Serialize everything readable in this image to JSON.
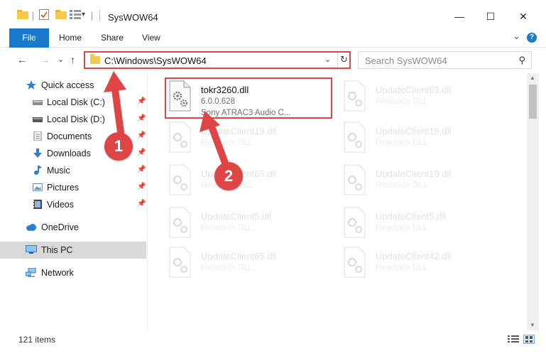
{
  "window": {
    "title": "SysWOW64",
    "minimize_label": "—",
    "maximize_label": "☐",
    "close_label": "✕"
  },
  "ribbon": {
    "tabs": [
      "File",
      "Home",
      "Share",
      "View"
    ],
    "expand_label": "⌄",
    "help_label": "?"
  },
  "address_bar": {
    "path": "C:\\Windows\\SysWOW64",
    "dropdown": "⌄",
    "refresh": "↻"
  },
  "search": {
    "placeholder": "Search SysWOW64",
    "icon": "⚲"
  },
  "nav": {
    "back": "←",
    "forward": "→",
    "recent": "⌄",
    "up": "↑"
  },
  "sidebar": {
    "quick_access": "Quick access",
    "items": [
      {
        "label": "Local Disk (C:)",
        "icon": "drive-icon"
      },
      {
        "label": "Local Disk (D:)",
        "icon": "drive-icon"
      },
      {
        "label": "Documents",
        "icon": "documents-icon"
      },
      {
        "label": "Downloads",
        "icon": "downloads-icon"
      },
      {
        "label": "Music",
        "icon": "music-icon"
      },
      {
        "label": "Pictures",
        "icon": "pictures-icon"
      },
      {
        "label": "Videos",
        "icon": "videos-icon"
      }
    ],
    "onedrive": "OneDrive",
    "this_pc": "This PC",
    "network": "Network",
    "pin_glyph": "📌"
  },
  "files": [
    {
      "name": "tokr3260.dll",
      "version": "6.0.0.628",
      "desc": "Sony ATRAC3 Audio C..."
    },
    {
      "name": "UpdateClient63.dll",
      "version": "Resource DLL",
      "desc": ""
    },
    {
      "name": "UpdateClient19.dll",
      "version": "Resource DLL",
      "desc": ""
    },
    {
      "name": "UpdateClient19.dll",
      "version": "Resource DLL",
      "desc": ""
    },
    {
      "name": "UpdateClient65.dll",
      "version": "Resource DLL",
      "desc": ""
    },
    {
      "name": "UpdateClient19.dll",
      "version": "Resource DLL",
      "desc": ""
    },
    {
      "name": "UpdateClient5.dll",
      "version": "Resource DLL",
      "desc": ""
    },
    {
      "name": "UpdateClient5.dll",
      "version": "Resource DLL",
      "desc": ""
    },
    {
      "name": "UpdateClient65.dll",
      "version": "Resource DLL",
      "desc": ""
    },
    {
      "name": "UpdateClient42.dll",
      "version": "Resource DLL",
      "desc": ""
    }
  ],
  "status": {
    "item_count": "121 items"
  },
  "annotations": {
    "step1": "1",
    "step2": "2"
  },
  "colors": {
    "accent": "#1979ca",
    "annotation": "#e04545",
    "folder": "#f3c94e"
  }
}
